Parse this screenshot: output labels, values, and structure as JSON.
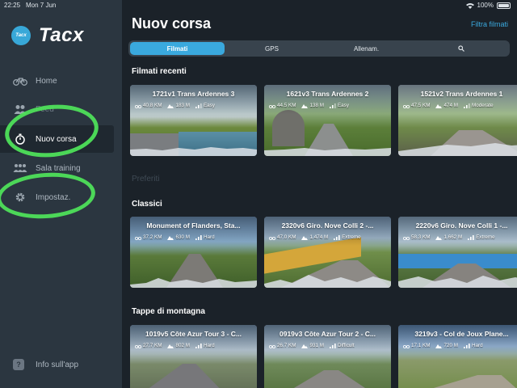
{
  "status_bar": {
    "time": "22:25",
    "date": "Mon 7 Jun",
    "battery": "100%"
  },
  "sidebar": {
    "logo_badge": "Tacx",
    "logo_text": "Tacx",
    "items": [
      {
        "label": "Home",
        "icon": "bicycle-icon"
      },
      {
        "label": "Feed",
        "icon": "people-icon"
      },
      {
        "label": "Nuov corsa",
        "icon": "stopwatch-icon"
      },
      {
        "label": "Sala training",
        "icon": "group-icon"
      },
      {
        "label": "Impostaz.",
        "icon": "gear-icon"
      }
    ],
    "info_label": "Info sull'app",
    "info_icon": "question-icon"
  },
  "main": {
    "title": "Nuov corsa",
    "filter_link": "Filtra filmati",
    "tabs": [
      {
        "label": "Filmati",
        "active": true
      },
      {
        "label": "GPS",
        "active": false
      },
      {
        "label": "Allenam.",
        "active": false
      },
      {
        "label": "",
        "icon": "search-icon",
        "active": false
      }
    ],
    "sections": {
      "recenti": "Filmati recenti",
      "preferiti": "Preferiti",
      "classici": "Classici",
      "montagna": "Tappe di montagna"
    },
    "recent_cards": [
      {
        "title": "1721v1 Trans Ardennes 3",
        "distance": "40.8 KM",
        "elevation": "183 M",
        "difficulty": "Easy"
      },
      {
        "title": "1621v3 Trans Ardennes 2",
        "distance": "44.5 KM",
        "elevation": "138 M",
        "difficulty": "Easy"
      },
      {
        "title": "1521v2 Trans Ardennes 1",
        "distance": "47.5 KM",
        "elevation": "474 M",
        "difficulty": "Moderate"
      }
    ],
    "classic_cards": [
      {
        "title": "Monument of Flanders, Sta...",
        "distance": "37.2 KM",
        "elevation": "630 M",
        "difficulty": "Hard"
      },
      {
        "title": "2320v6 Giro. Nove Colli 2 -...",
        "distance": "47.0 KM",
        "elevation": "1.474 M",
        "difficulty": "Extreme"
      },
      {
        "title": "2220v6 Giro. Nove Colli 1 -...",
        "distance": "58.3 KM",
        "elevation": "1.662 M",
        "difficulty": "Extreme"
      }
    ],
    "mountain_cards": [
      {
        "title": "1019v5 Côte Azur Tour 3 - C...",
        "distance": "27.7 KM",
        "elevation": "802 M",
        "difficulty": "Hard"
      },
      {
        "title": "0919v3 Côte Azur Tour 2 - C...",
        "distance": "26.7 KM",
        "elevation": "931 M",
        "difficulty": "Difficult"
      },
      {
        "title": "3219v3 - Col de Joux Plane...",
        "distance": "17.1 KM",
        "elevation": "720 M",
        "difficulty": "Hard"
      }
    ]
  },
  "colors": {
    "accent": "#3aa9de",
    "sidebar_bg": "#2b3640",
    "main_bg": "#1b2229",
    "annotation": "#4ee05a"
  }
}
